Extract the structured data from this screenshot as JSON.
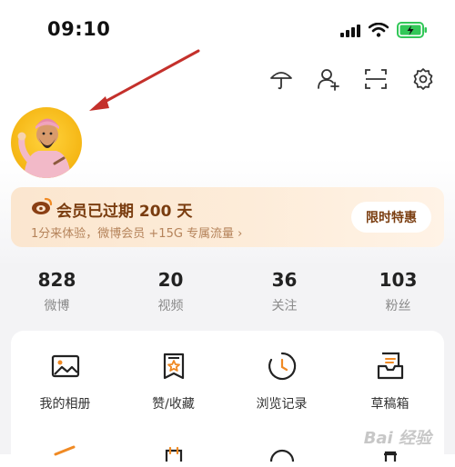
{
  "status_bar": {
    "time": "09:10"
  },
  "vip": {
    "title": "会员已过期 200 天",
    "subtitle": "1分来体验，微博会员 +15G 专属流量 ›",
    "button": "限时特惠"
  },
  "stats": [
    {
      "value": "828",
      "label": "微博"
    },
    {
      "value": "20",
      "label": "视频"
    },
    {
      "value": "36",
      "label": "关注"
    },
    {
      "value": "103",
      "label": "粉丝"
    }
  ],
  "grid": [
    {
      "label": "我的相册"
    },
    {
      "label": "赞/收藏"
    },
    {
      "label": "浏览记录"
    },
    {
      "label": "草稿箱"
    }
  ],
  "watermark": "Bai 经验",
  "colors": {
    "arrow": "#c4302b",
    "vip_text": "#7a3d10",
    "accent": "#f08a24",
    "battery": "#32c758"
  }
}
